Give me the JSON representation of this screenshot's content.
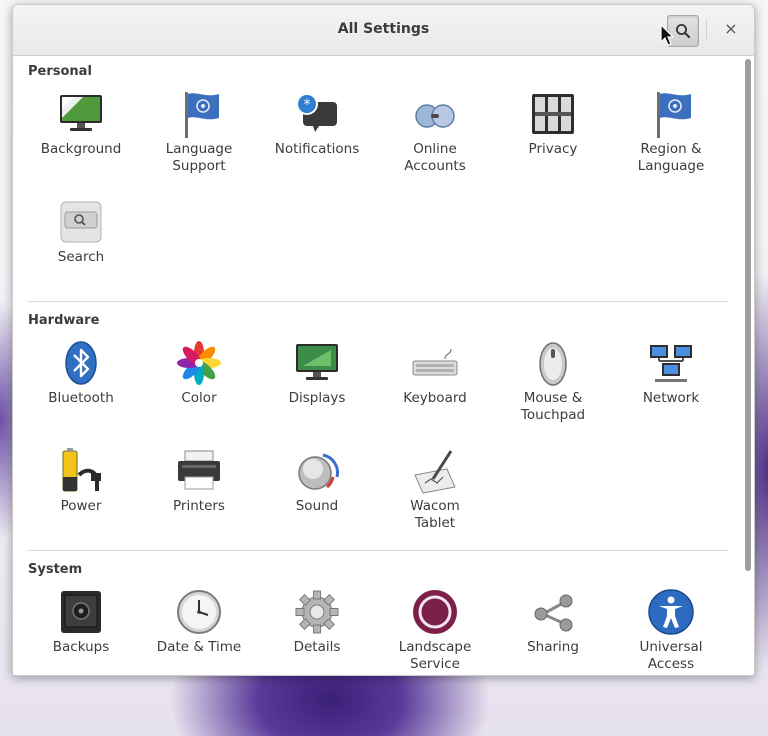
{
  "window": {
    "title": "All Settings",
    "search_icon": "search-icon",
    "close_label": "×"
  },
  "sections": [
    {
      "title": "Personal",
      "items": [
        {
          "label": "Background",
          "icon": "background-icon"
        },
        {
          "label": "Language\nSupport",
          "icon": "language-support-icon"
        },
        {
          "label": "Notifications",
          "icon": "notifications-icon"
        },
        {
          "label": "Online\nAccounts",
          "icon": "online-accounts-icon"
        },
        {
          "label": "Privacy",
          "icon": "privacy-icon"
        },
        {
          "label": "Region &\nLanguage",
          "icon": "region-language-icon"
        },
        {
          "label": "Search",
          "icon": "search-settings-icon"
        }
      ]
    },
    {
      "title": "Hardware",
      "items": [
        {
          "label": "Bluetooth",
          "icon": "bluetooth-icon"
        },
        {
          "label": "Color",
          "icon": "color-icon"
        },
        {
          "label": "Displays",
          "icon": "displays-icon"
        },
        {
          "label": "Keyboard",
          "icon": "keyboard-icon"
        },
        {
          "label": "Mouse &\nTouchpad",
          "icon": "mouse-icon"
        },
        {
          "label": "Network",
          "icon": "network-icon"
        },
        {
          "label": "Power",
          "icon": "power-icon"
        },
        {
          "label": "Printers",
          "icon": "printers-icon"
        },
        {
          "label": "Sound",
          "icon": "sound-icon"
        },
        {
          "label": "Wacom\nTablet",
          "icon": "wacom-tablet-icon"
        }
      ]
    },
    {
      "title": "System",
      "items": [
        {
          "label": "Backups",
          "icon": "backups-icon"
        },
        {
          "label": "Date & Time",
          "icon": "clock-icon"
        },
        {
          "label": "Details",
          "icon": "gear-icon"
        },
        {
          "label": "Landscape\nService",
          "icon": "landscape-icon"
        },
        {
          "label": "Sharing",
          "icon": "share-icon"
        },
        {
          "label": "Universal\nAccess",
          "icon": "accessibility-icon"
        }
      ]
    }
  ],
  "colors": {
    "landscape": "#7b1f4b",
    "bluetooth": "#2f6fc4",
    "universal_access": "#2d6bc0"
  }
}
